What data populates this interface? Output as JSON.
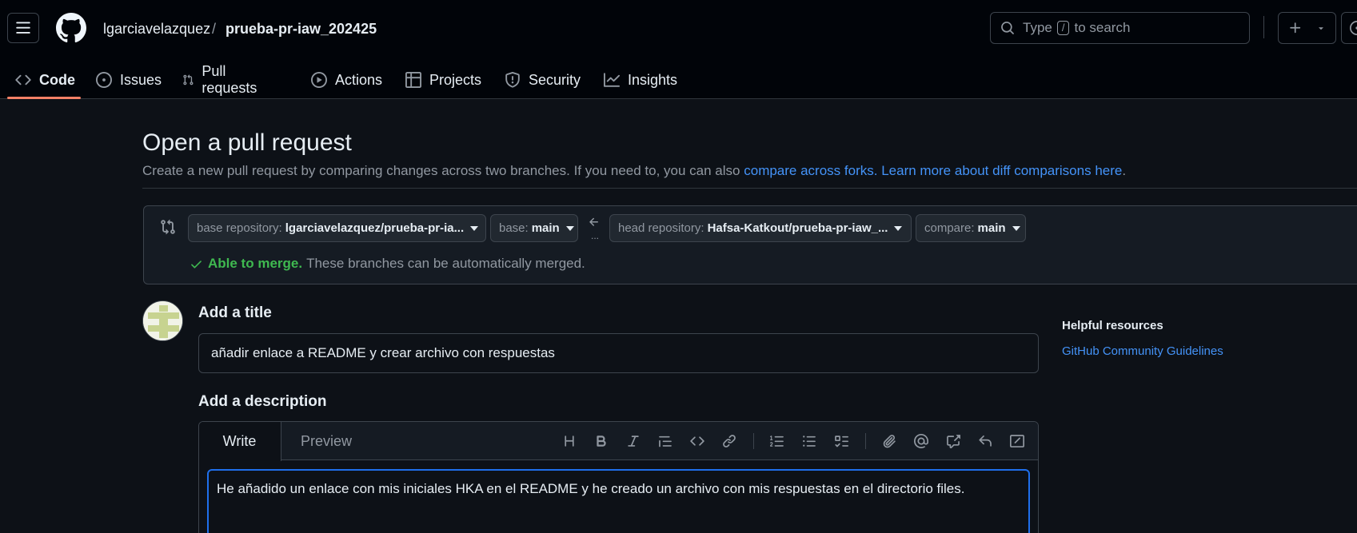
{
  "header": {
    "owner": "lgarciavelazquez",
    "separator": "/",
    "repo": "prueba-pr-iaw_202425",
    "search_prefix": "Type",
    "search_key": "/",
    "search_suffix": "to search"
  },
  "tabs": [
    {
      "label": "Code",
      "icon": "code-icon"
    },
    {
      "label": "Issues",
      "icon": "issue-opened-icon"
    },
    {
      "label": "Pull requests",
      "icon": "git-pull-request-icon"
    },
    {
      "label": "Actions",
      "icon": "play-icon"
    },
    {
      "label": "Projects",
      "icon": "table-icon"
    },
    {
      "label": "Security",
      "icon": "shield-icon"
    },
    {
      "label": "Insights",
      "icon": "graph-icon"
    }
  ],
  "page": {
    "title": "Open a pull request",
    "subtitle_text": "Create a new pull request by comparing changes across two branches. If you need to, you can also",
    "link_forks": "compare across forks.",
    "link_learn": "Learn more about diff comparisons here",
    "subtitle_end": "."
  },
  "compare": {
    "base_repo_label": "base repository:",
    "base_repo_value": "lgarciavelazquez/prueba-pr-ia...",
    "base_label": "base:",
    "base_value": "main",
    "head_repo_label": "head repository:",
    "head_repo_value": "Hafsa-Katkout/prueba-pr-iaw_...",
    "compare_label": "compare:",
    "compare_value": "main",
    "dots": "...",
    "merge_ok": "Able to merge.",
    "merge_msg": "These branches can be automatically merged."
  },
  "form": {
    "title_label": "Add a title",
    "title_value": "añadir enlace a README y crear archivo con respuestas",
    "desc_label": "Add a description",
    "tab_write": "Write",
    "tab_preview": "Preview",
    "toolbar": [
      "heading-icon",
      "bold-icon",
      "italic-icon",
      "quote-icon",
      "code-icon",
      "link-icon",
      "ordered-list-icon",
      "unordered-list-icon",
      "tasklist-icon",
      "paperclip-icon",
      "mention-icon",
      "cross-reference-icon",
      "reply-icon",
      "fullscreen-icon"
    ],
    "desc_value": "He añadido un enlace con mis iniciales HKA en el README y he creado un archivo con mis respuestas en el directorio files."
  },
  "sidebar": {
    "title": "Helpful resources",
    "link": "GitHub Community Guidelines"
  },
  "colors": {
    "accent_underline": "#f78166",
    "link": "#4493f8",
    "success": "#3fb950",
    "focus": "#1f6feb"
  }
}
